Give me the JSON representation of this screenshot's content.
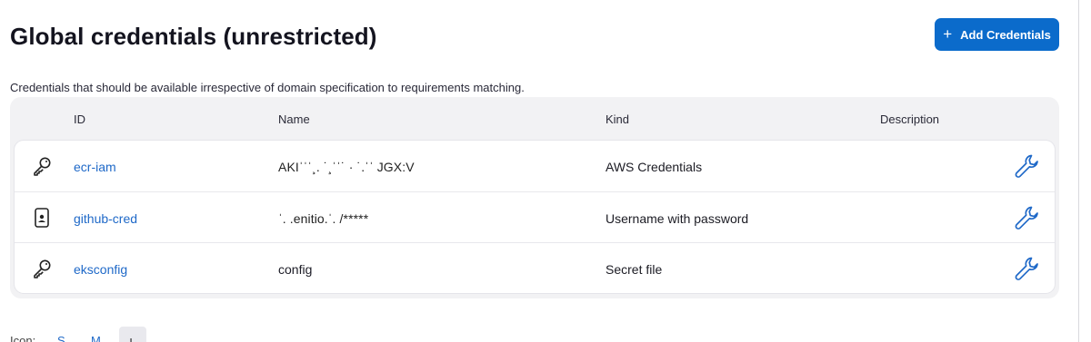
{
  "header": {
    "title": "Global credentials (unrestricted)",
    "add_button": "Add Credentials"
  },
  "description": "Credentials that should be available irrespective of domain specification to requirements matching.",
  "table": {
    "columns": [
      "ID",
      "Name",
      "Kind",
      "Description"
    ],
    "rows": [
      {
        "icon": "key-icon",
        "id": "ecr-iam",
        "name": "AKIˈˈˈ¸. ˙¸ˈˈ˙ · ˙.ˈˈ JGX:V",
        "kind": "AWS Credentials",
        "description": ""
      },
      {
        "icon": "phone-user-icon",
        "id": "github-cred",
        "name": "ˈ. .enitio.ˈ. /*****",
        "kind": "Username with password",
        "description": ""
      },
      {
        "icon": "key-icon",
        "id": "eksconfig",
        "name": "config",
        "kind": "Secret file",
        "description": ""
      }
    ]
  },
  "icon_size": {
    "label": "Icon:",
    "options": [
      "S",
      "M",
      "L"
    ]
  },
  "colors": {
    "accent": "#0b6bcb",
    "link": "#1f69c8",
    "table_bg": "#f2f2f4"
  }
}
